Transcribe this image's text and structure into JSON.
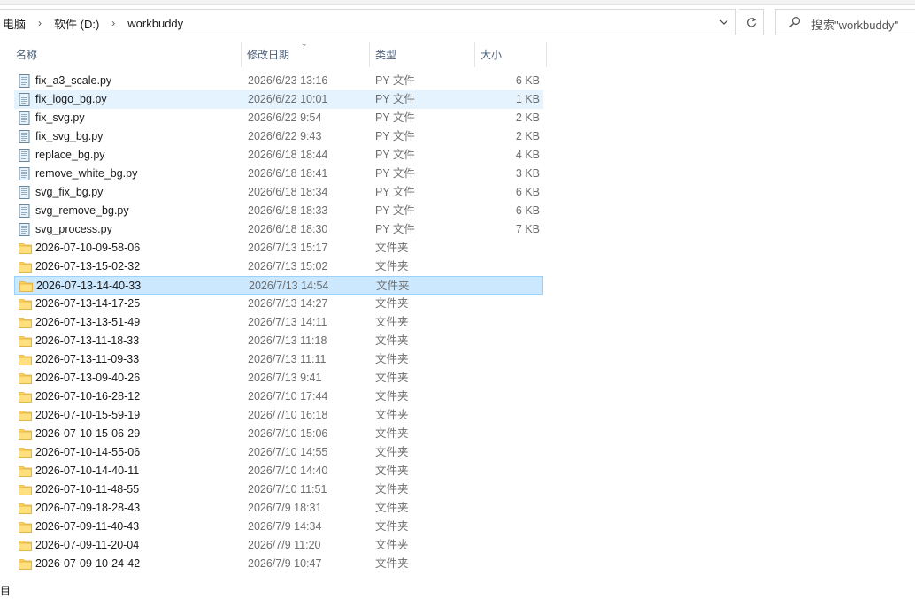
{
  "address": {
    "crumbs": [
      "电脑",
      "软件 (D:)",
      "workbuddy"
    ],
    "separator": "›"
  },
  "search": {
    "placeholder": "搜索\"workbuddy\""
  },
  "columns": {
    "name": "名称",
    "date": "修改日期",
    "type": "类型",
    "size": "大小"
  },
  "files": [
    {
      "name": "fix_a3_scale.py",
      "date": "2026/6/23 13:16",
      "type": "PY 文件",
      "size": "6 KB",
      "kind": "py"
    },
    {
      "name": "fix_logo_bg.py",
      "date": "2026/6/22 10:01",
      "type": "PY 文件",
      "size": "1 KB",
      "kind": "py"
    },
    {
      "name": "fix_svg.py",
      "date": "2026/6/22 9:54",
      "type": "PY 文件",
      "size": "2 KB",
      "kind": "py"
    },
    {
      "name": "fix_svg_bg.py",
      "date": "2026/6/22 9:43",
      "type": "PY 文件",
      "size": "2 KB",
      "kind": "py"
    },
    {
      "name": "replace_bg.py",
      "date": "2026/6/18 18:44",
      "type": "PY 文件",
      "size": "4 KB",
      "kind": "py"
    },
    {
      "name": "remove_white_bg.py",
      "date": "2026/6/18 18:41",
      "type": "PY 文件",
      "size": "3 KB",
      "kind": "py"
    },
    {
      "name": "svg_fix_bg.py",
      "date": "2026/6/18 18:34",
      "type": "PY 文件",
      "size": "6 KB",
      "kind": "py"
    },
    {
      "name": "svg_remove_bg.py",
      "date": "2026/6/18 18:33",
      "type": "PY 文件",
      "size": "6 KB",
      "kind": "py"
    },
    {
      "name": "svg_process.py",
      "date": "2026/6/18 18:30",
      "type": "PY 文件",
      "size": "7 KB",
      "kind": "py"
    },
    {
      "name": "2026-07-10-09-58-06",
      "date": "2026/7/13 15:17",
      "type": "文件夹",
      "size": "",
      "kind": "folder"
    },
    {
      "name": "2026-07-13-15-02-32",
      "date": "2026/7/13 15:02",
      "type": "文件夹",
      "size": "",
      "kind": "folder"
    },
    {
      "name": "2026-07-13-14-40-33",
      "date": "2026/7/13 14:54",
      "type": "文件夹",
      "size": "",
      "kind": "folder"
    },
    {
      "name": "2026-07-13-14-17-25",
      "date": "2026/7/13 14:27",
      "type": "文件夹",
      "size": "",
      "kind": "folder"
    },
    {
      "name": "2026-07-13-13-51-49",
      "date": "2026/7/13 14:11",
      "type": "文件夹",
      "size": "",
      "kind": "folder"
    },
    {
      "name": "2026-07-13-11-18-33",
      "date": "2026/7/13 11:18",
      "type": "文件夹",
      "size": "",
      "kind": "folder"
    },
    {
      "name": "2026-07-13-11-09-33",
      "date": "2026/7/13 11:11",
      "type": "文件夹",
      "size": "",
      "kind": "folder"
    },
    {
      "name": "2026-07-13-09-40-26",
      "date": "2026/7/13 9:41",
      "type": "文件夹",
      "size": "",
      "kind": "folder"
    },
    {
      "name": "2026-07-10-16-28-12",
      "date": "2026/7/10 17:44",
      "type": "文件夹",
      "size": "",
      "kind": "folder"
    },
    {
      "name": "2026-07-10-15-59-19",
      "date": "2026/7/10 16:18",
      "type": "文件夹",
      "size": "",
      "kind": "folder"
    },
    {
      "name": "2026-07-10-15-06-29",
      "date": "2026/7/10 15:06",
      "type": "文件夹",
      "size": "",
      "kind": "folder"
    },
    {
      "name": "2026-07-10-14-55-06",
      "date": "2026/7/10 14:55",
      "type": "文件夹",
      "size": "",
      "kind": "folder"
    },
    {
      "name": "2026-07-10-14-40-11",
      "date": "2026/7/10 14:40",
      "type": "文件夹",
      "size": "",
      "kind": "folder"
    },
    {
      "name": "2026-07-10-11-48-55",
      "date": "2026/7/10 11:51",
      "type": "文件夹",
      "size": "",
      "kind": "folder"
    },
    {
      "name": "2026-07-09-18-28-43",
      "date": "2026/7/9 18:31",
      "type": "文件夹",
      "size": "",
      "kind": "folder"
    },
    {
      "name": "2026-07-09-11-40-43",
      "date": "2026/7/9 14:34",
      "type": "文件夹",
      "size": "",
      "kind": "folder"
    },
    {
      "name": "2026-07-09-11-20-04",
      "date": "2026/7/9 11:20",
      "type": "文件夹",
      "size": "",
      "kind": "folder"
    },
    {
      "name": "2026-07-09-10-24-42",
      "date": "2026/7/9 10:47",
      "type": "文件夹",
      "size": "",
      "kind": "folder"
    }
  ],
  "hovered_row": 1,
  "selected_row": 11,
  "status": {
    "text": "目"
  },
  "colors": {
    "hover": "#e5f3ff",
    "selected": "#cce8ff",
    "selected_border": "#99d1ff",
    "folder": "#ffd35c"
  }
}
